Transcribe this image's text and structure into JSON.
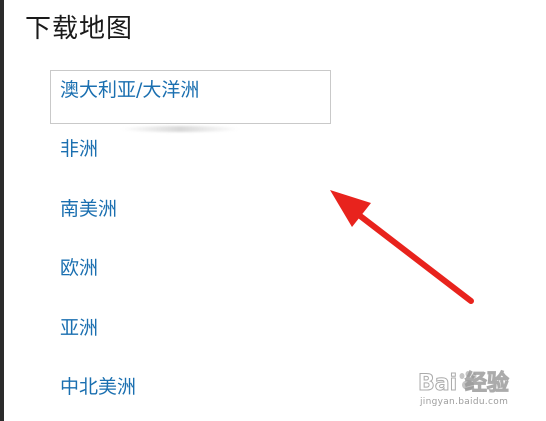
{
  "page": {
    "title": "下载地图"
  },
  "regions": [
    {
      "label": "澳大利亚/大洋洲",
      "selected": true
    },
    {
      "label": "非洲",
      "selected": false
    },
    {
      "label": "南美洲",
      "selected": false
    },
    {
      "label": "欧洲",
      "selected": false
    },
    {
      "label": "亚洲",
      "selected": false
    },
    {
      "label": "中北美洲",
      "selected": false
    }
  ],
  "colors": {
    "link": "#1a6fb0",
    "title": "#1a1a1a",
    "selection_border": "#c9c9c9",
    "annotation_arrow": "#e8231d"
  },
  "watermark": {
    "logo_text": "Bai 经验",
    "site": "jingyan.baidu.com"
  },
  "icons": {
    "annotation": "red-arrow-icon",
    "watermark": "baidu-paw-icon"
  }
}
